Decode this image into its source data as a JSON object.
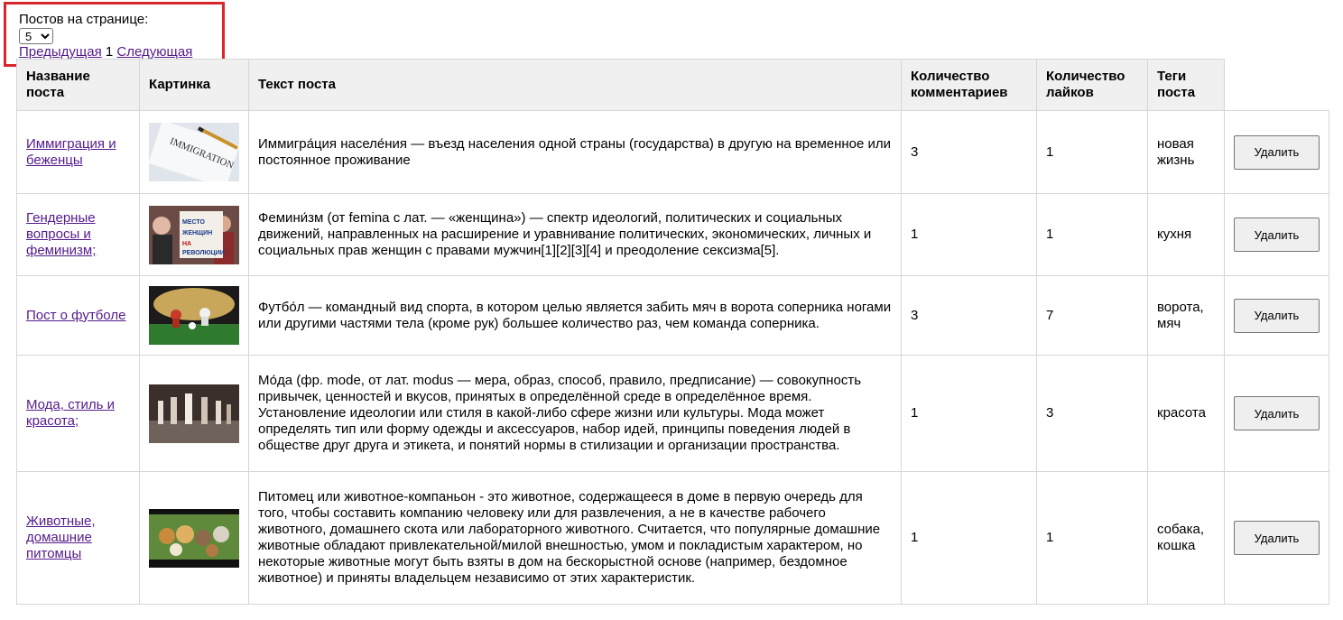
{
  "pagination": {
    "per_page_label": "Постов на странице:",
    "per_page_value": "5",
    "prev_label": "Предыдущая",
    "current_page": "1",
    "next_label": "Следующая"
  },
  "table": {
    "headers": {
      "title": "Название поста",
      "image": "Картинка",
      "text": "Текст поста",
      "comments": "Количество комментариев",
      "likes": "Количество лайков",
      "tags": "Теги поста"
    },
    "delete_label": "Удалить",
    "rows": [
      {
        "title": "Иммиграция и беженцы",
        "text": "Иммигра́ция населе́ния — въезд населения одной страны (государства) в другую на временное или постоянное проживание",
        "comments": "3",
        "likes": "1",
        "tags": "новая жизнь"
      },
      {
        "title": "Гендерные вопросы и феминизм;",
        "text": "Фемини́зм (от femina с лат. — «женщина») — спектр идеологий, политических и социальных движений, направленных на расширение и уравнивание политических, экономических, личных и социальных прав женщин с правами мужчин[1][2][3][4] и преодоление сексизма[5].",
        "comments": "1",
        "likes": "1",
        "tags": "кухня"
      },
      {
        "title": "Пост о футболе",
        "text": "Футбо́л — командный вид спорта, в котором целью является забить мяч в ворота соперника ногами или другими частями тела (кроме рук) большее количество раз, чем команда соперника.",
        "comments": "3",
        "likes": "7",
        "tags": "ворота, мяч"
      },
      {
        "title": "Мода, стиль и красота;",
        "text": "Мо́да (фр. mode, от лат. modus — мера, образ, способ, правило, предписание) — совокупность привычек, ценностей и вкусов, принятых в определённой среде в определённое время. Установление идеологии или стиля в какой-либо сфере жизни или культуры. Мода может определять тип или форму одежды и аксессуаров, набор идей, принципы поведения людей в обществе друг друга и этикета, и понятий нормы в стилизации и организации пространства.",
        "comments": "1",
        "likes": "3",
        "tags": "красота"
      },
      {
        "title": "Животные, домашние питомцы",
        "text": "Питомец или животное-компаньон - это животное, содержащееся в доме в первую очередь для того, чтобы составить компанию человеку или для развлечения, а не в качестве рабочего животного, домашнего скота или лабораторного животного. Считается, что популярные домашние животные обладают привлекательной/милой внешностью, умом и покладистым характером, но некоторые животные могут быть взяты в дом на бескорыстной основе (например, бездомное животное) и приняты владельцем независимо от этих характеристик.",
        "comments": "1",
        "likes": "1",
        "tags": "собака, кошка"
      }
    ]
  }
}
